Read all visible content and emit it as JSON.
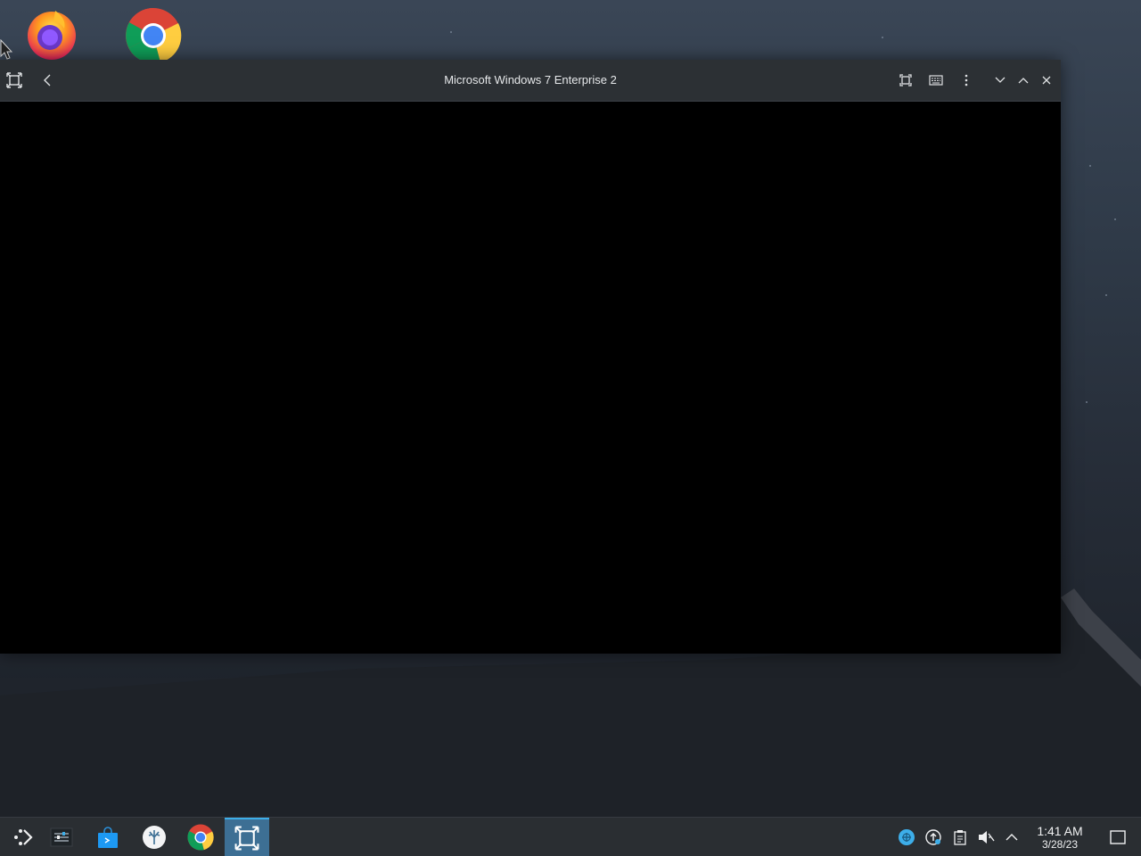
{
  "window": {
    "title": "Microsoft Windows 7 Enterprise 2"
  },
  "desktop": {
    "icons": [
      {
        "name": "firefox-icon"
      },
      {
        "name": "chrome-icon"
      }
    ]
  },
  "taskbar": {
    "items": [
      "application-launcher",
      "task-manager",
      "discover-store",
      "plasma-app",
      "chrome",
      "virt-manager"
    ],
    "active_item": "virt-manager",
    "tray": [
      "network-icon",
      "update-icon",
      "clipboard-icon",
      "volume-muted-icon",
      "tray-expand-icon"
    ],
    "clock": {
      "time": "1:41 AM",
      "date": "3/28/23"
    }
  },
  "colors": {
    "accent": "#3daee9",
    "titlebar": "#2c3034",
    "taskbar": "#2a2e32"
  }
}
